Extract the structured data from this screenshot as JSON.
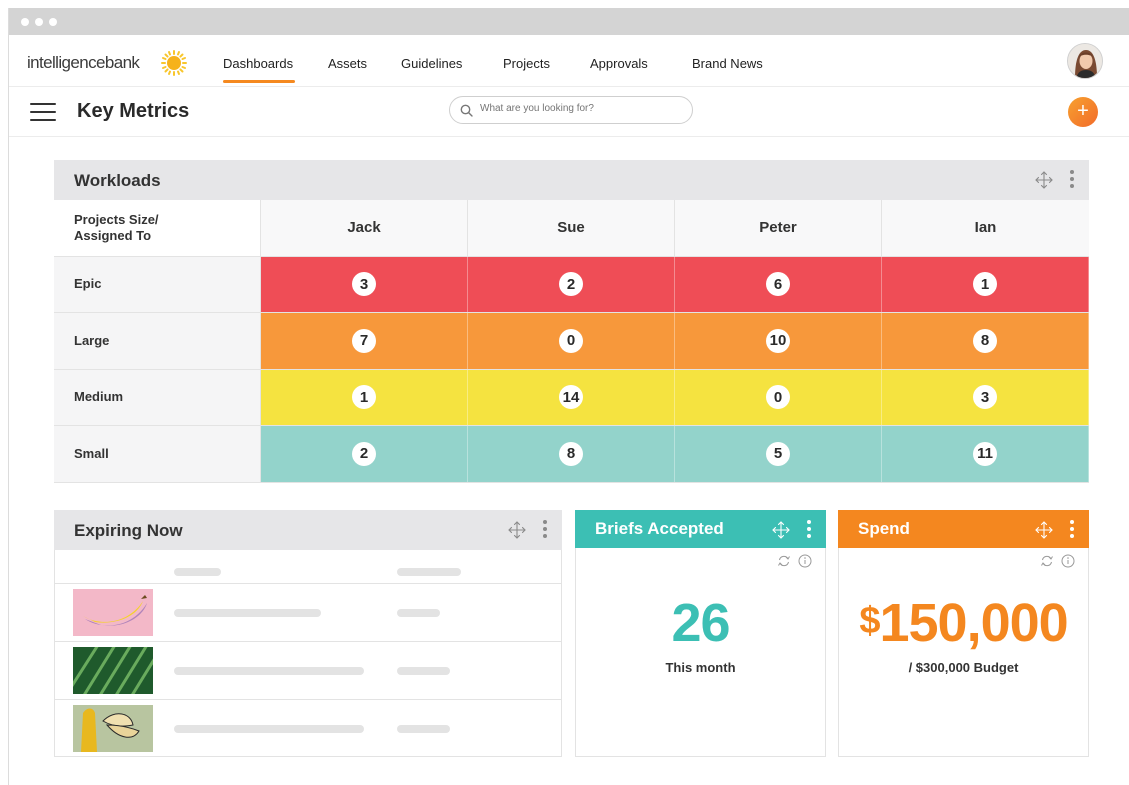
{
  "colors": {
    "accent": "#f5891f",
    "epic": "#ef4d56",
    "large": "#f7983b",
    "medium": "#f5e340",
    "small": "#93d3cb",
    "briefs": "#3cbfb4",
    "spend": "#f4871f"
  },
  "topnav": {
    "logo": "intelligencebank",
    "items": [
      {
        "label": "Dashboards",
        "active": true
      },
      {
        "label": "Assets"
      },
      {
        "label": "Guidelines"
      },
      {
        "label": "Projects"
      },
      {
        "label": "Approvals"
      },
      {
        "label": "Brand News"
      }
    ]
  },
  "header": {
    "title": "Key Metrics",
    "search_placeholder": "What are you looking for?",
    "add_label": "+"
  },
  "workloads": {
    "title": "Workloads",
    "corner_label_line1": "Projects Size/",
    "corner_label_line2": "Assigned To",
    "columns": [
      "Jack",
      "Sue",
      "Peter",
      "Ian"
    ],
    "rows": [
      {
        "label": "Epic",
        "values": [
          "3",
          "2",
          "6",
          "1"
        ]
      },
      {
        "label": "Large",
        "values": [
          "7",
          "0",
          "10",
          "8"
        ]
      },
      {
        "label": "Medium",
        "values": [
          "1",
          "14",
          "0",
          "3"
        ]
      },
      {
        "label": "Small",
        "values": [
          "2",
          "8",
          "5",
          "11"
        ]
      }
    ]
  },
  "expiring": {
    "title": "Expiring Now",
    "items": [
      {
        "thumb": "banana"
      },
      {
        "thumb": "leaf"
      },
      {
        "thumb": "butterfly"
      }
    ]
  },
  "briefs": {
    "title": "Briefs Accepted",
    "value": "26",
    "caption": "This month"
  },
  "spend": {
    "title": "Spend",
    "currency": "$",
    "value": "150,000",
    "caption": "/ $300,000 Budget"
  }
}
